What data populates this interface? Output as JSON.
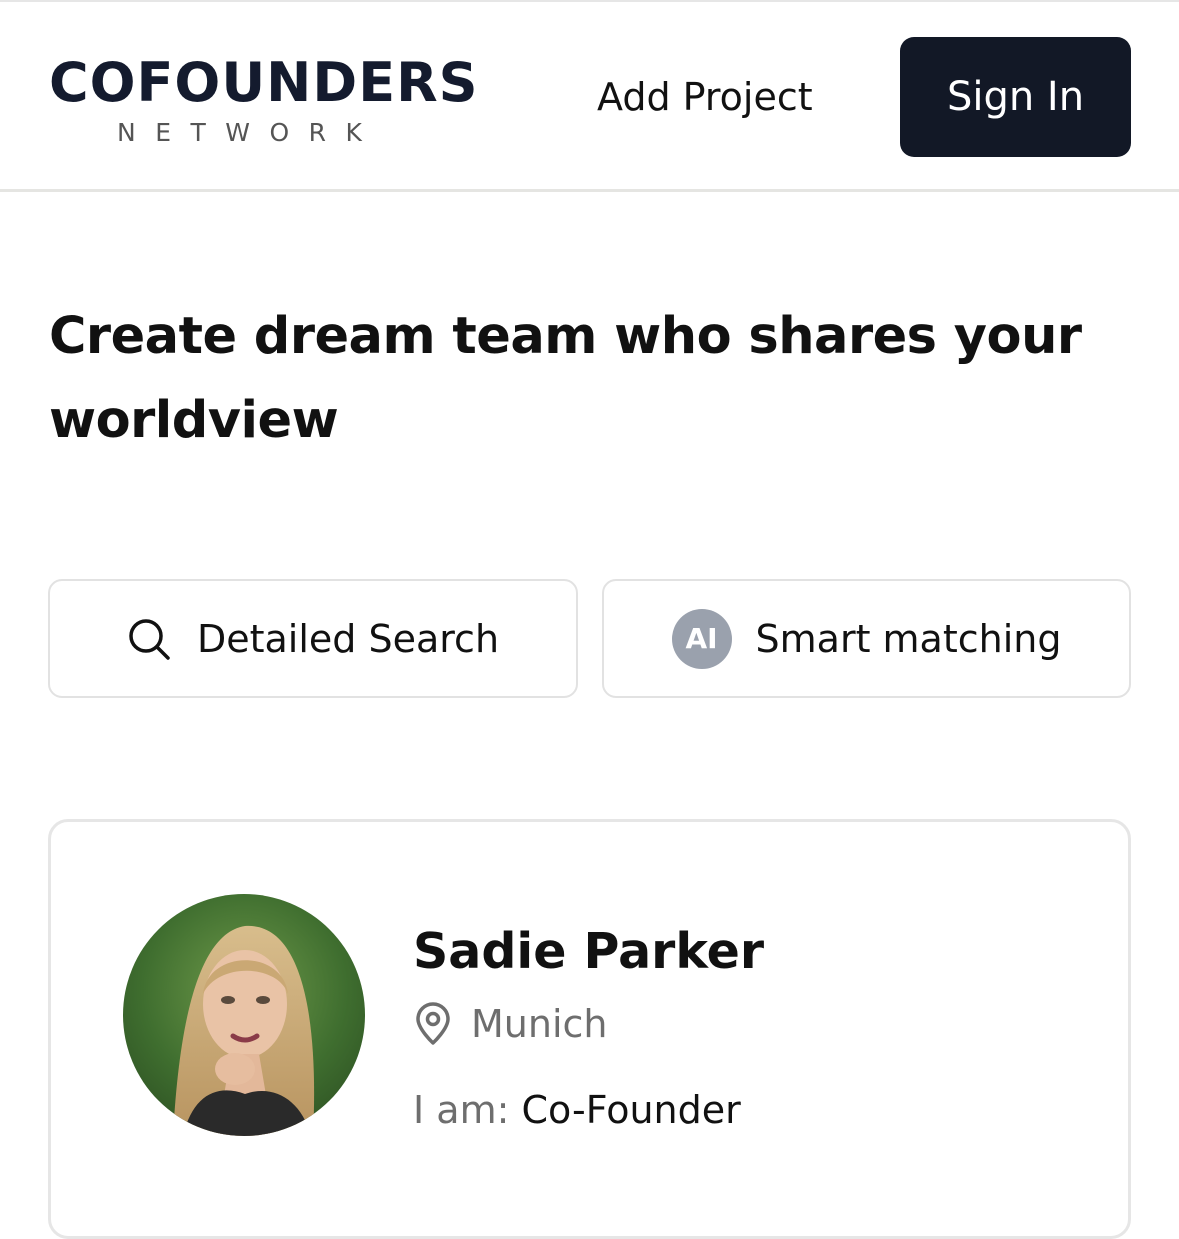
{
  "header": {
    "logo_main": "COFOUNDERS",
    "logo_sub": "NETWORK",
    "add_project_label": "Add Project",
    "sign_in_label": "Sign In"
  },
  "hero": {
    "headline": "Create dream team who shares your worldview"
  },
  "actions": {
    "detailed_search_label": "Detailed Search",
    "detailed_search_icon": "search-icon",
    "smart_matching_label": "Smart matching",
    "smart_matching_badge": "AI"
  },
  "profile_card": {
    "name": "Sadie Parker",
    "location_icon": "location-pin-icon",
    "location": "Munich",
    "role_label": "I am:",
    "role_value": "Co-Founder"
  },
  "colors": {
    "primary_dark": "#121826",
    "logo_navy": "#141b2e",
    "ai_badge": "#9aa1ad",
    "muted_text": "#6e6e6e",
    "border": "#e2e2e2"
  }
}
